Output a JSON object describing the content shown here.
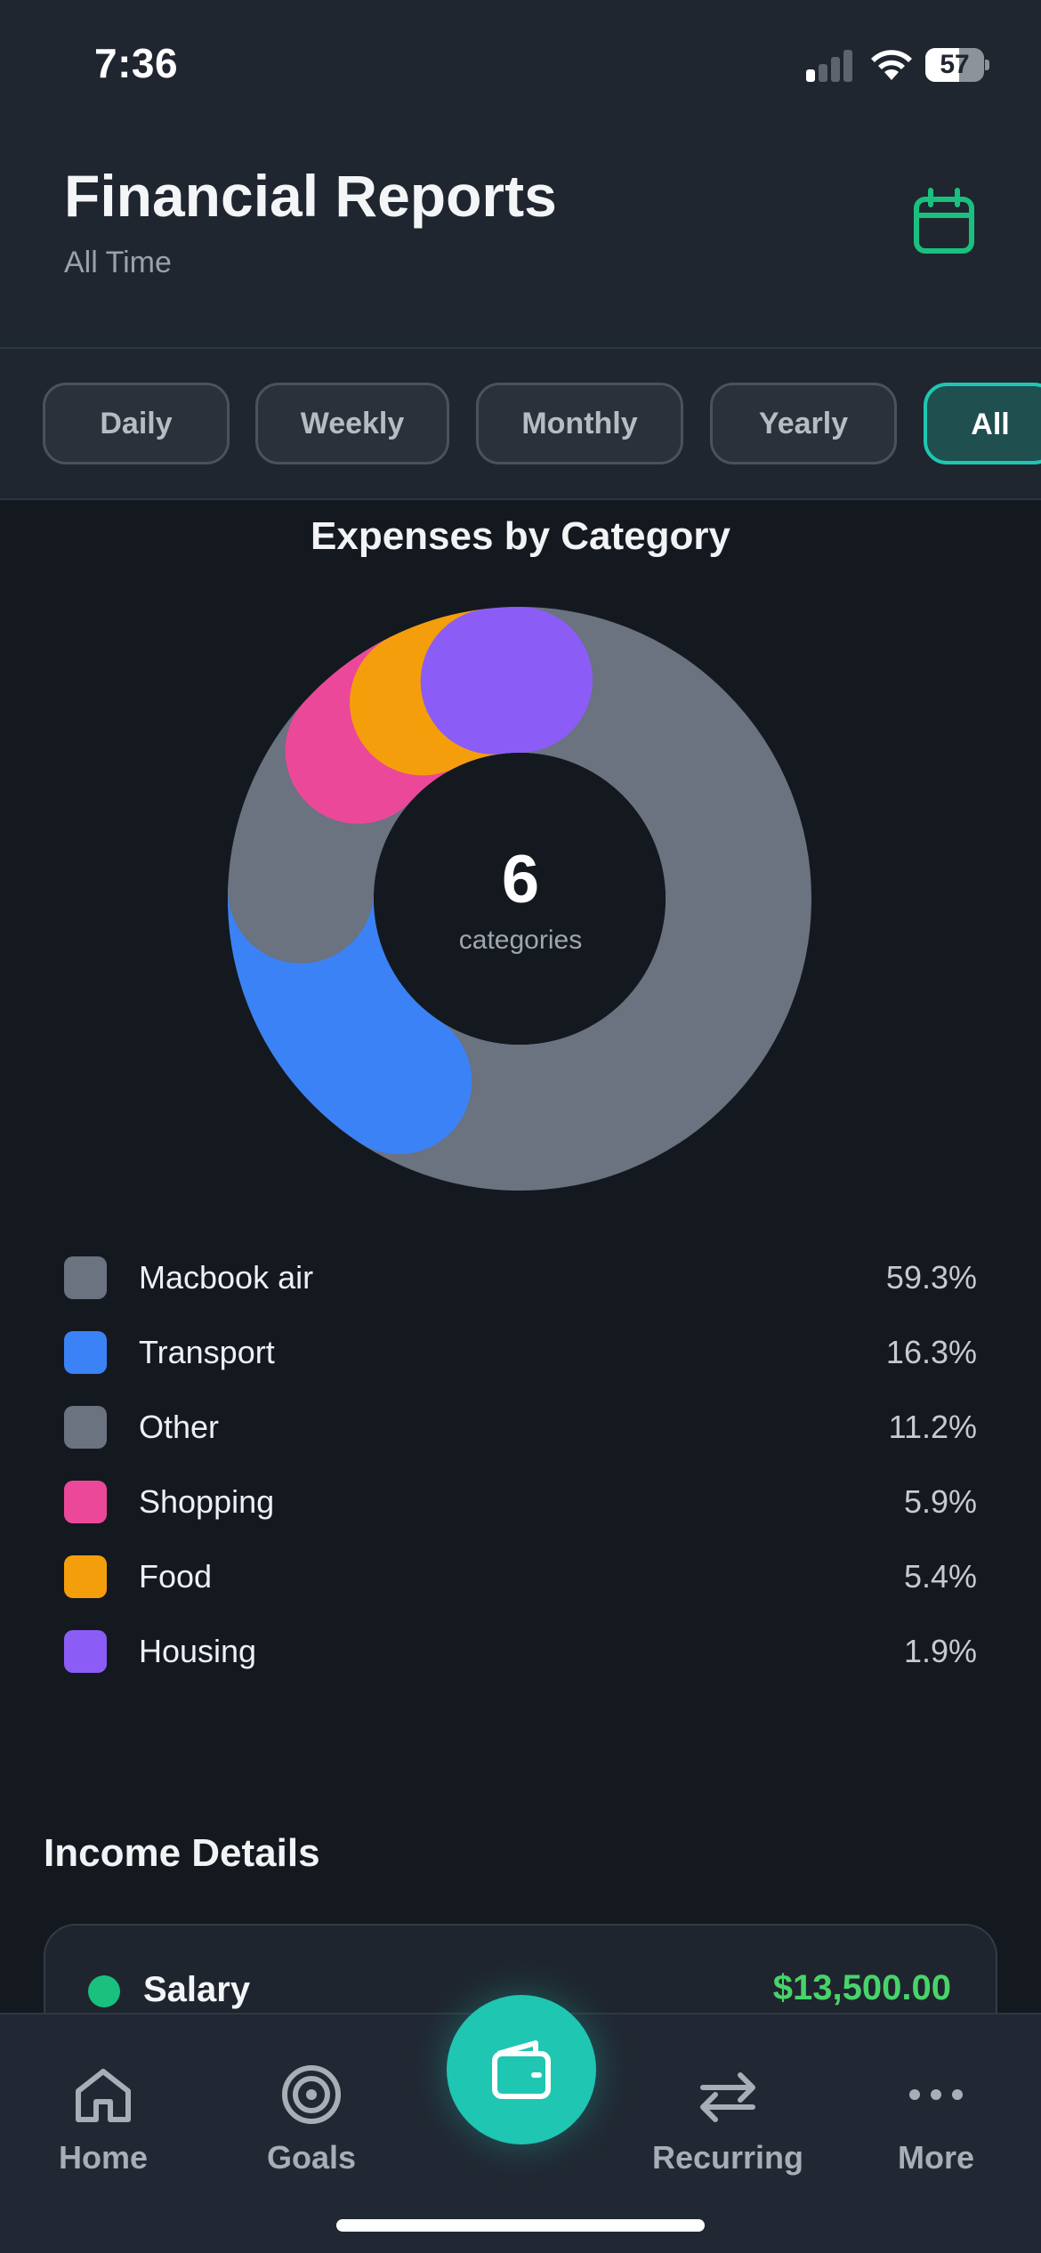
{
  "status_bar": {
    "time": "7:36",
    "battery": "57",
    "battery_level": 0.57
  },
  "header": {
    "title": "Financial Reports",
    "subtitle": "All Time",
    "calendar_icon": "calendar-icon"
  },
  "filters": {
    "items": [
      {
        "label": "Daily",
        "active": false
      },
      {
        "label": "Weekly",
        "active": false
      },
      {
        "label": "Monthly",
        "active": false
      },
      {
        "label": "Yearly",
        "active": false
      },
      {
        "label": "All",
        "active": true
      }
    ]
  },
  "chart_data": {
    "type": "pie",
    "title": "Expenses by Category",
    "center_value": "6",
    "center_label": "categories",
    "categories": [
      "Macbook air",
      "Transport",
      "Other",
      "Shopping",
      "Food",
      "Housing"
    ],
    "values": [
      59.3,
      16.3,
      11.2,
      5.9,
      5.4,
      1.9
    ],
    "value_labels": [
      "59.3%",
      "16.3%",
      "11.2%",
      "5.9%",
      "5.4%",
      "1.9%"
    ],
    "colors": [
      "#6b7280",
      "#3b82f6",
      "#6b7280",
      "#ec4899",
      "#f59e0b",
      "#8b5cf6"
    ],
    "legend_position": "below"
  },
  "income": {
    "title": "Income Details",
    "items": [
      {
        "label": "Salary",
        "amount": "$13,500.00",
        "color": "#19c07e"
      }
    ]
  },
  "tab_bar": {
    "items": [
      {
        "label": "Home",
        "icon": "home-icon"
      },
      {
        "label": "Goals",
        "icon": "target-icon"
      },
      {
        "label": "Recurring",
        "icon": "repeat-icon"
      },
      {
        "label": "More",
        "icon": "more-icon"
      }
    ],
    "fab_icon": "wallet-icon",
    "accent": "#1fc6b2"
  }
}
